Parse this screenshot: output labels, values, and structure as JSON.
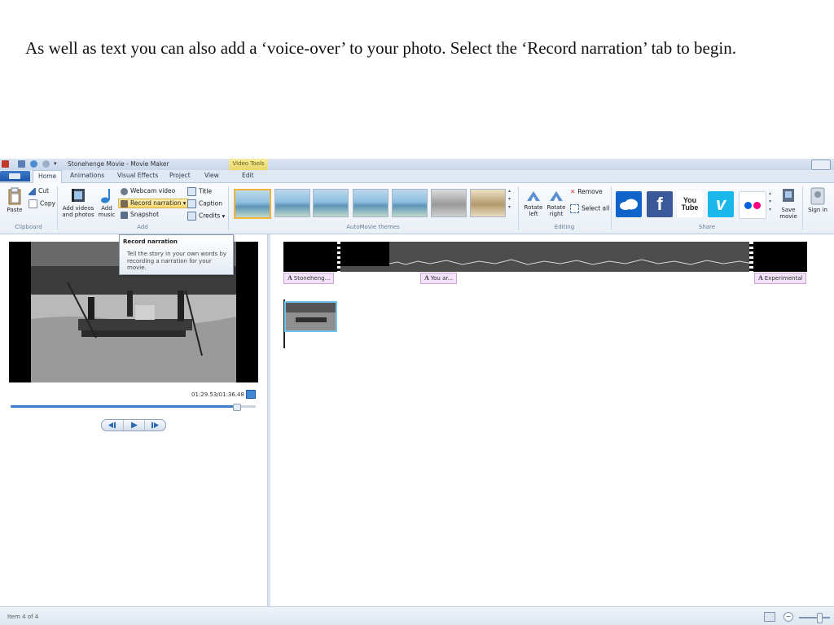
{
  "slide_text": "As well as text you can also add a ‘voice-over’ to your photo. Select the ‘Record narration’ tab to begin.",
  "window": {
    "title": "Stonehenge Movie - Movie Maker",
    "context_tab": "Video Tools"
  },
  "tabs": [
    "Home",
    "Animations",
    "Visual Effects",
    "Project",
    "View",
    "Edit"
  ],
  "ribbon": {
    "clipboard": {
      "paste": "Paste",
      "cut": "Cut",
      "copy": "Copy",
      "label": "Clipboard"
    },
    "add": {
      "add_videos": "Add videos and photos",
      "add_music": "Add music",
      "webcam": "Webcam video",
      "record_narration": "Record narration",
      "snapshot": "Snapshot",
      "title": "Title",
      "caption": "Caption",
      "credits": "Credits",
      "label": "Add"
    },
    "themes_label": "AutoMovie themes",
    "editing": {
      "rotate_left": "Rotate left",
      "rotate_right": "Rotate right",
      "remove": "Remove",
      "select_all": "Select all",
      "label": "Editing"
    },
    "share": {
      "label": "Share",
      "services": [
        "onedrive-icon",
        "facebook-icon",
        "youtube-icon",
        "vimeo-icon",
        "flickr-icon"
      ],
      "youtube_text": "You Tube",
      "vimeo_text": "v",
      "facebook_text": "f",
      "save_movie": "Save movie",
      "sign_in": "Sign in"
    }
  },
  "tooltip": {
    "title": "Record narration",
    "body": "Tell the story in your own words by recording a narration for your movie."
  },
  "player": {
    "time": "01:29.53/01:36.48",
    "progress": 0.92
  },
  "storyboard": {
    "captions": [
      "Stoneheng...",
      "You ar...",
      "Experimental"
    ]
  },
  "status": {
    "text": "Item 4 of 4"
  },
  "colors": {
    "accent": "#3b7cc9",
    "highlight": "#f8d86e",
    "facebook": "#3b5998",
    "youtube": "#c4302b",
    "vimeo": "#1ab7ea",
    "onedrive": "#0f63c9"
  }
}
